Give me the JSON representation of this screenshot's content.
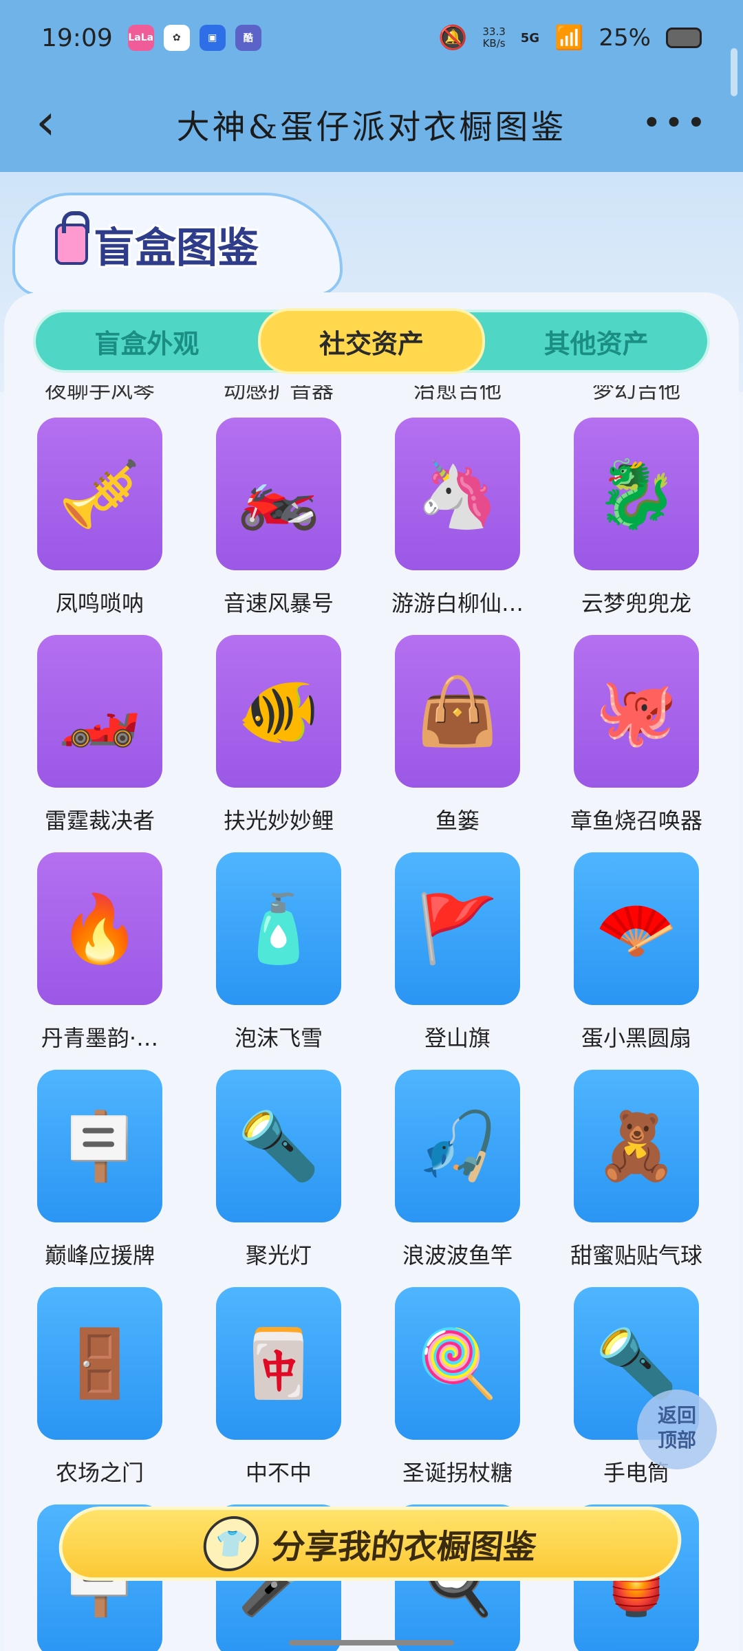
{
  "status": {
    "time": "19:09",
    "net_speed_top": "33.3",
    "net_speed_bottom": "KB/s",
    "signal": "5G",
    "battery": "25%",
    "app_badges": [
      {
        "text": "LaLa",
        "color": "#f05c97"
      },
      {
        "text": "✿",
        "color": "#333333"
      },
      {
        "text": "▣",
        "color": "#2e6fe8"
      },
      {
        "text": "酷",
        "color": "#5b63c9"
      }
    ]
  },
  "header": {
    "title": "大神&蛋仔派对衣橱图鉴",
    "back_symbol": "‹",
    "more_symbol": "•••"
  },
  "banner": {
    "title": "盲盒图鉴"
  },
  "tabs": [
    {
      "label": "盲盒外观",
      "active": false
    },
    {
      "label": "社交资产",
      "active": true
    },
    {
      "label": "其他资产",
      "active": false
    }
  ],
  "cut_row_labels": [
    "夜聊手风琴",
    "动感扩音器",
    "治愈吉他",
    "梦幻吉他"
  ],
  "items": [
    {
      "label": "凤鸣唢呐",
      "color": "purple",
      "icon": "🎺"
    },
    {
      "label": "音速风暴号",
      "color": "purple",
      "icon": "🏍️"
    },
    {
      "label": "游游白柳仙…",
      "color": "purple",
      "icon": "🦄"
    },
    {
      "label": "云梦兜兜龙",
      "color": "purple",
      "icon": "🐉"
    },
    {
      "label": "雷霆裁决者",
      "color": "purple",
      "icon": "🏎️"
    },
    {
      "label": "扶光妙妙鲤",
      "color": "purple",
      "icon": "🐠"
    },
    {
      "label": "鱼篓",
      "color": "purple",
      "icon": "👜"
    },
    {
      "label": "章鱼烧召唤器",
      "color": "purple",
      "icon": "🐙"
    },
    {
      "label": "丹青墨韵·…",
      "color": "purple",
      "icon": "🔥"
    },
    {
      "label": "泡沫飞雪",
      "color": "blue",
      "icon": "🧴"
    },
    {
      "label": "登山旗",
      "color": "blue",
      "icon": "🚩"
    },
    {
      "label": "蛋小黑圆扇",
      "color": "blue",
      "icon": "🪭"
    },
    {
      "label": "巅峰应援牌",
      "color": "blue",
      "icon": "🪧"
    },
    {
      "label": "聚光灯",
      "color": "blue",
      "icon": "🔦"
    },
    {
      "label": "浪波波鱼竿",
      "color": "blue",
      "icon": "🎣"
    },
    {
      "label": "甜蜜贴贴气球",
      "color": "blue",
      "icon": "🧸"
    },
    {
      "label": "农场之门",
      "color": "blue",
      "icon": "🚪"
    },
    {
      "label": "中不中",
      "color": "blue",
      "icon": "🀄"
    },
    {
      "label": "圣诞拐杖糖",
      "color": "blue",
      "icon": "🍭"
    },
    {
      "label": "手电筒",
      "color": "blue",
      "icon": "🔦"
    },
    {
      "label": "",
      "color": "blue",
      "icon": "🪧"
    },
    {
      "label": "",
      "color": "blue",
      "icon": "🎤"
    },
    {
      "label": "",
      "color": "blue",
      "icon": "🍳"
    },
    {
      "label": "",
      "color": "blue",
      "icon": "🏮"
    }
  ],
  "back_to_top": {
    "line1": "返回",
    "line2": "顶部"
  },
  "share_button": {
    "label": "分享我的衣橱图鉴",
    "icon": "👕"
  }
}
